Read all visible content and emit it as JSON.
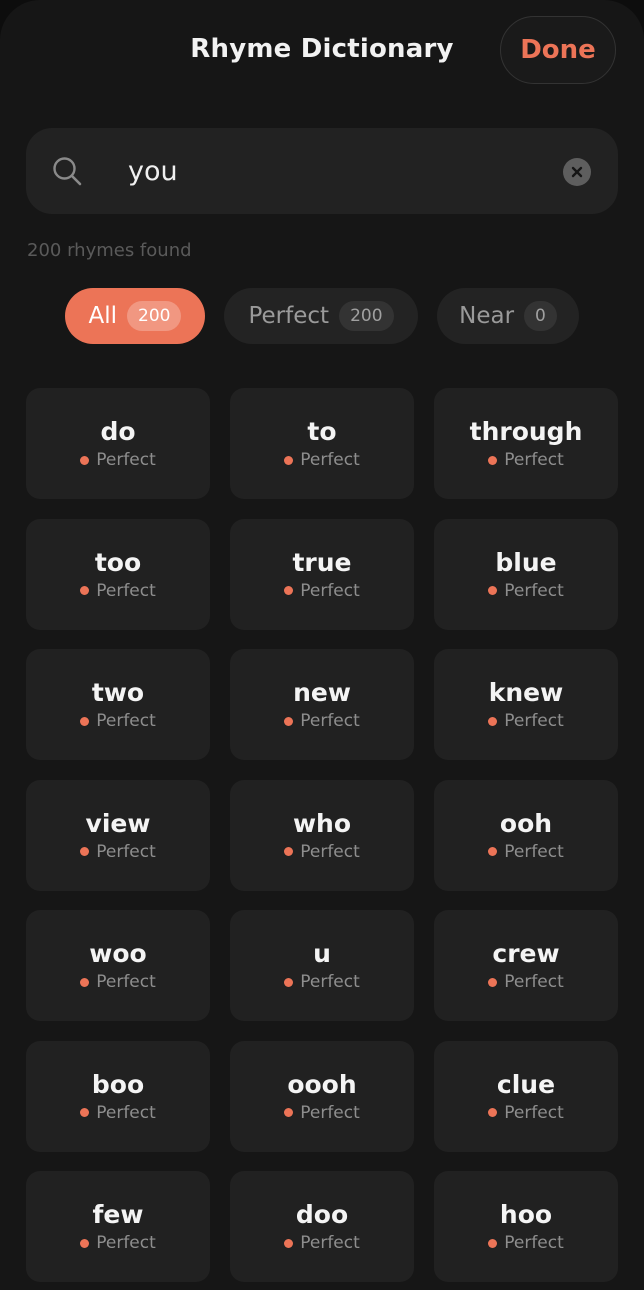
{
  "header": {
    "title": "Rhyme Dictionary",
    "done_label": "Done"
  },
  "search": {
    "value": "you",
    "icon": "search-icon",
    "clear_icon": "clear-icon"
  },
  "results_count": "200 rhymes found",
  "filters": [
    {
      "label": "All",
      "count": "200",
      "active": true
    },
    {
      "label": "Perfect",
      "count": "200",
      "active": false
    },
    {
      "label": "Near",
      "count": "0",
      "active": false
    }
  ],
  "rhymes": [
    {
      "word": "do",
      "type": "Perfect"
    },
    {
      "word": "to",
      "type": "Perfect"
    },
    {
      "word": "through",
      "type": "Perfect"
    },
    {
      "word": "too",
      "type": "Perfect"
    },
    {
      "word": "true",
      "type": "Perfect"
    },
    {
      "word": "blue",
      "type": "Perfect"
    },
    {
      "word": "two",
      "type": "Perfect"
    },
    {
      "word": "new",
      "type": "Perfect"
    },
    {
      "word": "knew",
      "type": "Perfect"
    },
    {
      "word": "view",
      "type": "Perfect"
    },
    {
      "word": "who",
      "type": "Perfect"
    },
    {
      "word": "ooh",
      "type": "Perfect"
    },
    {
      "word": "woo",
      "type": "Perfect"
    },
    {
      "word": "u",
      "type": "Perfect"
    },
    {
      "word": "crew",
      "type": "Perfect"
    },
    {
      "word": "boo",
      "type": "Perfect"
    },
    {
      "word": "oooh",
      "type": "Perfect"
    },
    {
      "word": "clue",
      "type": "Perfect"
    },
    {
      "word": "few",
      "type": "Perfect"
    },
    {
      "word": "doo",
      "type": "Perfect"
    },
    {
      "word": "hoo",
      "type": "Perfect"
    }
  ],
  "colors": {
    "accent": "#ec7457",
    "background": "#161616",
    "card": "#212121"
  }
}
